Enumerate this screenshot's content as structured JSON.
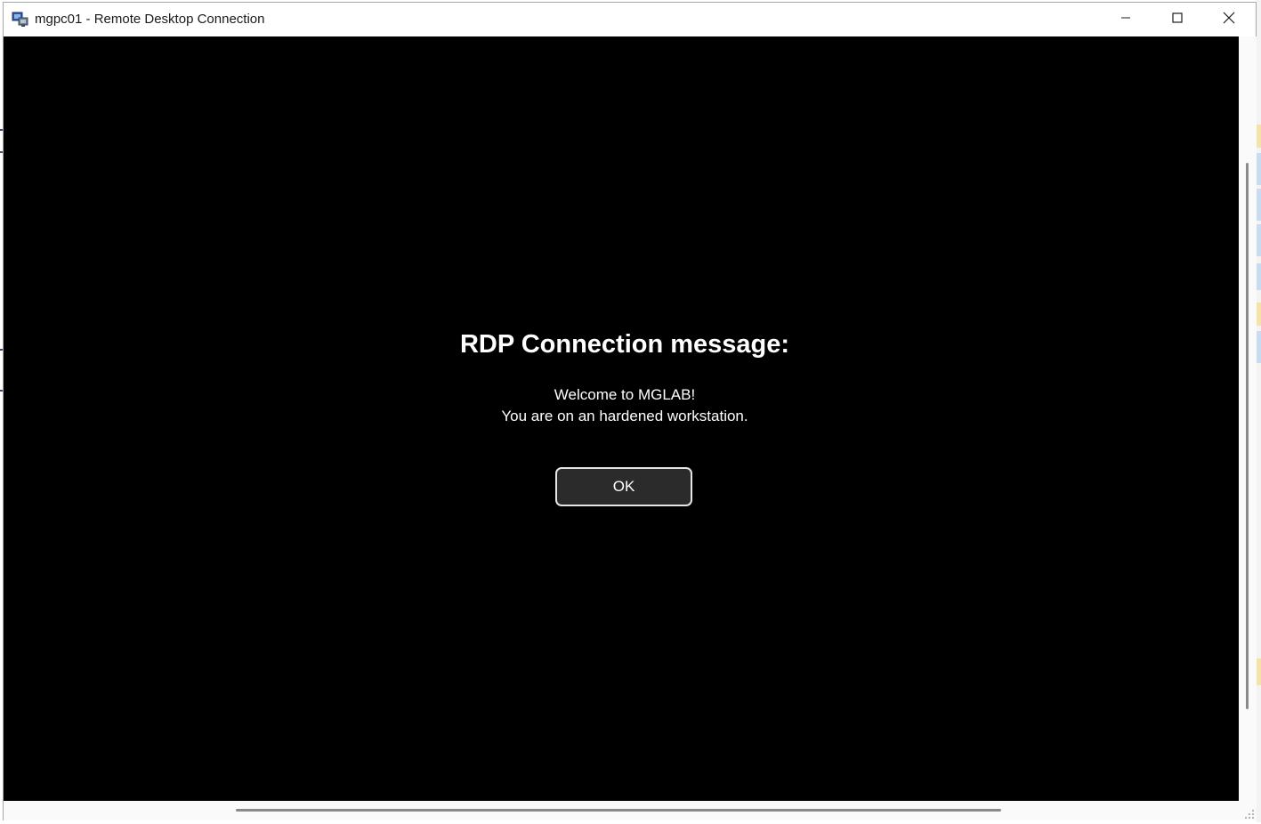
{
  "window": {
    "title": "mgpc01 - Remote Desktop Connection",
    "icon": "remote-desktop-icon",
    "controls": [
      "minimize-icon",
      "maximize-icon",
      "close-icon"
    ]
  },
  "remote_session": {
    "background": "#000000",
    "message_title": "RDP Connection message:",
    "message_lines": [
      "Welcome to MGLAB!",
      "You are on an hardened workstation."
    ],
    "ok_label": "OK"
  },
  "colors": {
    "remote_background": "#000000",
    "text": "#ffffff",
    "button_fill": "#2b2b2b",
    "button_border": "#e6e6e6"
  }
}
